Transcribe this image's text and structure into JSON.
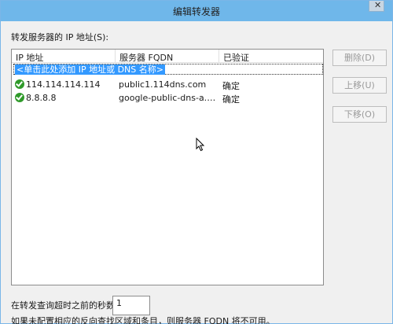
{
  "window": {
    "title": "编辑转发器",
    "close_label": "✕"
  },
  "ip_list": {
    "label": "转发服务器的 IP 地址(S):",
    "columns": [
      "IP 地址",
      "服务器 FQDN",
      "已验证"
    ],
    "add_placeholder": "<单击此处添加 IP 地址或 DNS 名称>",
    "rows": [
      {
        "ip": "114.114.114.114",
        "fqdn": "public1.114dns.com",
        "verified": "确定"
      },
      {
        "ip": "8.8.8.8",
        "fqdn": "google-public-dns-a.go...",
        "verified": "确定"
      }
    ]
  },
  "buttons": {
    "delete": "删除(D)",
    "move_up": "上移(U)",
    "move_down": "下移(O)"
  },
  "timeout": {
    "label": "在转发查询超时之前的秒数:",
    "value": "1"
  },
  "footer_note": "如果未配置相应的反向查找区域和条目，则服务器 FQDN 将不可用。",
  "colors": {
    "titlebar": "#6fb7ea",
    "selection": "#3399ff",
    "check": "#2f9a2a"
  }
}
